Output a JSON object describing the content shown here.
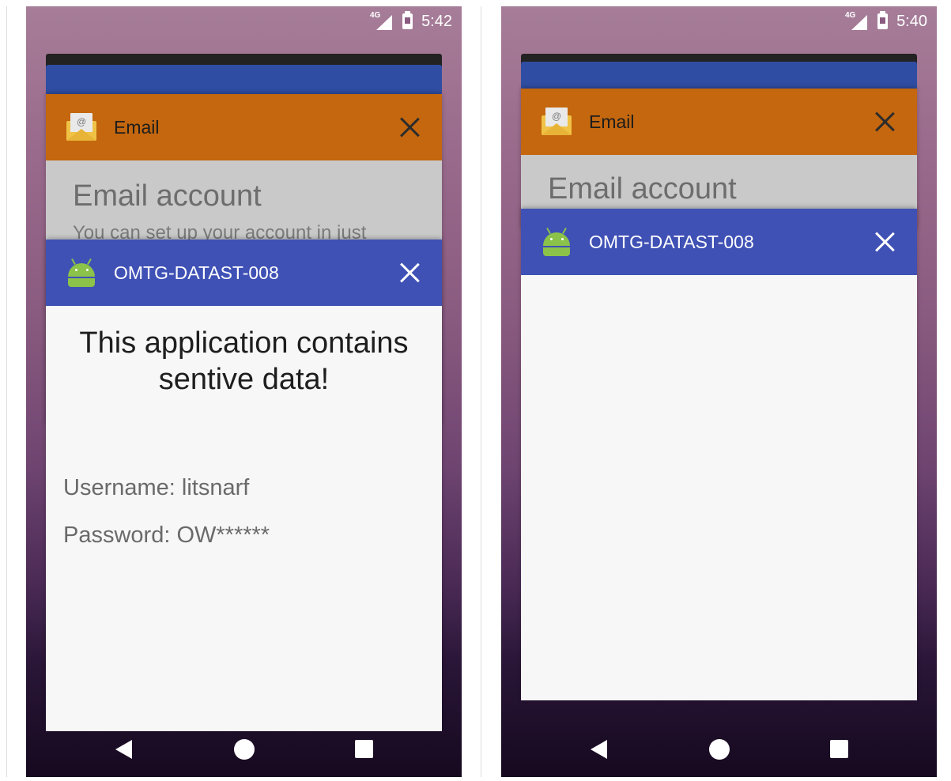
{
  "screens": [
    {
      "status": {
        "time": "5:42",
        "network": "4G"
      },
      "cards": {
        "email": {
          "title": "Email",
          "heading": "Email account",
          "subtext": "You can set up your account in just"
        },
        "app": {
          "title": "OMTG-DATAST-008",
          "headline": "This application contains sentive data!",
          "username": "Username: litsnarf",
          "password": "Password: OW******"
        }
      }
    },
    {
      "status": {
        "time": "5:40",
        "network": "4G"
      },
      "cards": {
        "email": {
          "title": "Email",
          "heading": "Email account"
        },
        "app": {
          "title": "OMTG-DATAST-008"
        }
      }
    }
  ],
  "icons": {
    "email_app": "email-envelope-icon",
    "android_app": "android-icon",
    "close": "close-icon",
    "nav": [
      "back-icon",
      "home-icon",
      "recents-icon"
    ]
  },
  "colors": {
    "email_header": "#c4670e",
    "app_header": "#3f51b5",
    "back_card": "#2f4ea3"
  }
}
